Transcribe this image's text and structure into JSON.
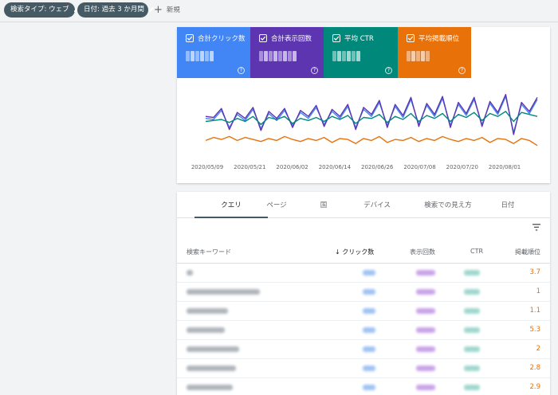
{
  "filters": {
    "search_type": "検索タイプ: ウェブ",
    "date": "日付: 過去 3 か月間",
    "new_label": "新規"
  },
  "metrics": [
    {
      "label": "合計クリック数",
      "color": "#4285f4"
    },
    {
      "label": "合計表示回数",
      "color": "#5e35b1"
    },
    {
      "label": "平均 CTR",
      "color": "#00897b"
    },
    {
      "label": "平均掲載順位",
      "color": "#e8710a"
    }
  ],
  "chart_data": {
    "type": "line",
    "x": [
      "2020/05/09",
      "2020/05/21",
      "2020/06/02",
      "2020/06/14",
      "2020/06/26",
      "2020/07/08",
      "2020/07/20",
      "2020/08/01"
    ],
    "series": [
      {
        "color": "#4285f4",
        "values": [
          36,
          35,
          44,
          27,
          40,
          34,
          45,
          26,
          41,
          34,
          44,
          29,
          42,
          36,
          47,
          30,
          43,
          36,
          48,
          27,
          45,
          38,
          52,
          29,
          48,
          37,
          55,
          30,
          49,
          38,
          56,
          29,
          50,
          39,
          55,
          30,
          51,
          40,
          58,
          22,
          50,
          41,
          55
        ]
      },
      {
        "color": "#5e35b1",
        "values": [
          38,
          37,
          46,
          25,
          42,
          36,
          47,
          24,
          43,
          36,
          46,
          27,
          44,
          38,
          49,
          28,
          45,
          38,
          50,
          25,
          47,
          40,
          54,
          27,
          50,
          39,
          57,
          28,
          51,
          40,
          58,
          27,
          52,
          41,
          57,
          28,
          53,
          42,
          60,
          20,
          52,
          43,
          57
        ]
      },
      {
        "color": "#00897b",
        "values": [
          33,
          34,
          35,
          32,
          36,
          33,
          38,
          30,
          37,
          35,
          38,
          31,
          36,
          34,
          37,
          33,
          38,
          35,
          39,
          31,
          37,
          36,
          40,
          32,
          38,
          35,
          41,
          33,
          39,
          36,
          41,
          33,
          40,
          37,
          42,
          34,
          41,
          38,
          43,
          33,
          42,
          40,
          38
        ]
      },
      {
        "color": "#e8710a",
        "values": [
          14,
          17,
          15,
          18,
          14,
          17,
          15,
          13,
          16,
          14,
          18,
          15,
          13,
          16,
          14,
          17,
          12,
          16,
          15,
          11,
          16,
          14,
          18,
          12,
          15,
          14,
          17,
          13,
          16,
          14,
          18,
          15,
          13,
          16,
          14,
          17,
          12,
          16,
          15,
          11,
          16,
          14,
          9
        ]
      }
    ],
    "ylim": [
      0,
      70
    ]
  },
  "table": {
    "tabs": [
      "クエリ",
      "ページ",
      "国",
      "デバイス",
      "検索での見え方",
      "日付"
    ],
    "columns": {
      "keyword": "検索キーワード",
      "clicks": "クリック数",
      "impressions": "表示回数",
      "ctr": "CTR",
      "position": "掲載順位"
    },
    "rows": [
      {
        "position": "3.7"
      },
      {
        "position": "1"
      },
      {
        "position": "1.1"
      },
      {
        "position": "5.3"
      },
      {
        "position": "2"
      },
      {
        "position": "2.8"
      },
      {
        "position": "2.9"
      }
    ]
  }
}
